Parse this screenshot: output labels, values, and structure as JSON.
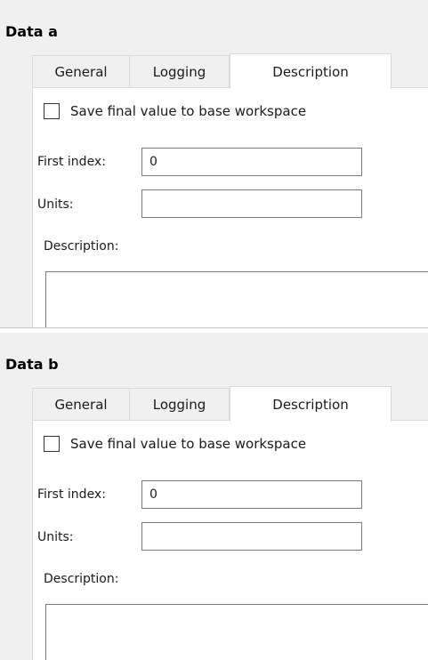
{
  "panels": [
    {
      "title": "Data a",
      "tabs": [
        "General",
        "Logging",
        "Description"
      ],
      "active_tab": "Description",
      "checkbox_label": "Save final value to base workspace",
      "checkbox_checked": false,
      "first_index_label": "First index:",
      "first_index_value": "0",
      "units_label": "Units:",
      "units_value": "",
      "description_label": "Description:",
      "description_value": ""
    },
    {
      "title": "Data b",
      "tabs": [
        "General",
        "Logging",
        "Description"
      ],
      "active_tab": "Description",
      "checkbox_label": "Save final value to base workspace",
      "checkbox_checked": false,
      "first_index_label": "First index:",
      "first_index_value": "0",
      "units_label": "Units:",
      "units_value": "",
      "description_label": "Description:",
      "description_value": ""
    }
  ]
}
